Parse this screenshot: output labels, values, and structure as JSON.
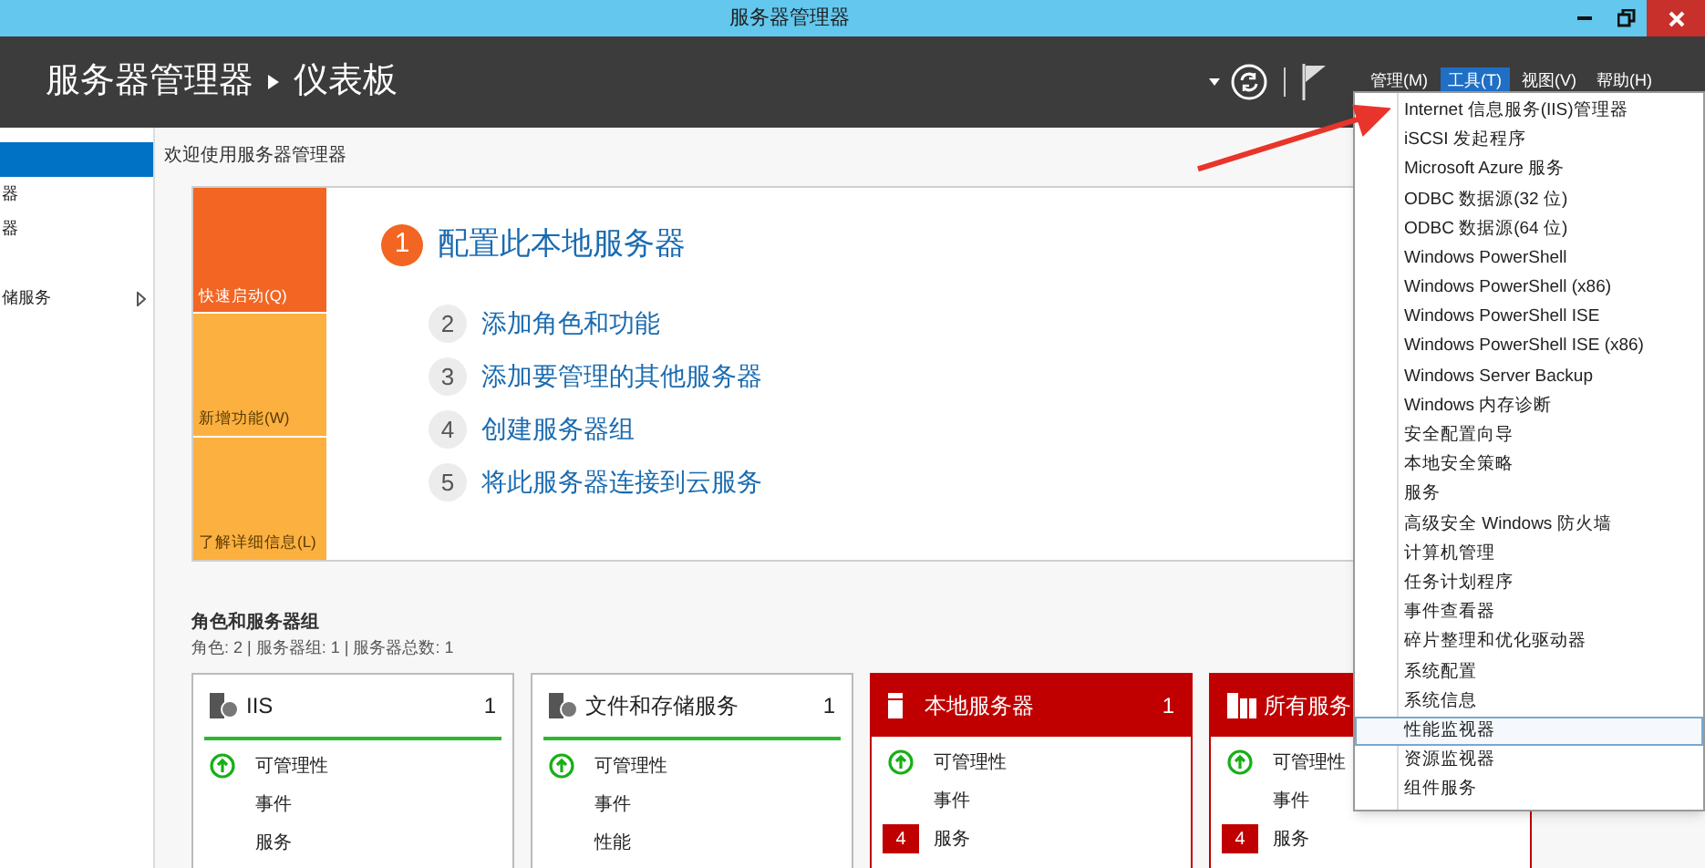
{
  "window": {
    "title": "服务器管理器"
  },
  "header": {
    "breadcrumb": [
      "服务器管理器",
      "仪表板"
    ],
    "menus": [
      {
        "label": "管理(M)",
        "selected": false
      },
      {
        "label": "工具(T)",
        "selected": true
      },
      {
        "label": "视图(V)",
        "selected": false
      },
      {
        "label": "帮助(H)",
        "selected": false
      }
    ]
  },
  "sidebar": {
    "items": [
      {
        "selected": true,
        "expandable": false
      },
      {
        "label": "器",
        "selected": false,
        "expandable": false
      },
      {
        "label": "器",
        "selected": false,
        "expandable": false
      },
      {
        "label": "储服务",
        "selected": false,
        "expandable": true
      }
    ]
  },
  "welcome": {
    "title": "欢迎使用服务器管理器",
    "tiles": [
      {
        "label": "快速启动(Q)",
        "selected": true
      },
      {
        "label": "新增功能(W)",
        "selected": false
      },
      {
        "label": "了解详细信息(L)",
        "selected": false
      }
    ],
    "steps": [
      {
        "number": "1",
        "label": "配置此本地服务器",
        "kind": "primary"
      },
      {
        "number": "2",
        "label": "添加角色和功能",
        "kind": "secondary"
      },
      {
        "number": "3",
        "label": "添加要管理的其他服务器",
        "kind": "secondary"
      },
      {
        "number": "4",
        "label": "创建服务器组",
        "kind": "secondary"
      },
      {
        "number": "5",
        "label": "将此服务器连接到云服务",
        "kind": "secondary"
      }
    ]
  },
  "roles": {
    "title": "角色和服务器组",
    "summary": "角色: 2 | 服务器组: 1 | 服务器总数: 1",
    "cards": [
      {
        "title": "IIS",
        "count": "1",
        "kind": "role",
        "rows": [
          {
            "label": "可管理性",
            "healthy": true
          },
          {
            "label": "事件",
            "healthy": false
          },
          {
            "label": "服务",
            "healthy": false
          }
        ]
      },
      {
        "title": "文件和存储服务",
        "count": "1",
        "kind": "role",
        "rows": [
          {
            "label": "可管理性",
            "healthy": true
          },
          {
            "label": "事件",
            "healthy": false
          },
          {
            "label": "性能",
            "healthy": false
          }
        ]
      },
      {
        "title": "本地服务器",
        "count": "1",
        "kind": "server",
        "rows": [
          {
            "label": "可管理性",
            "healthy": true
          },
          {
            "label": "事件",
            "healthy": false
          },
          {
            "label": "服务",
            "healthy": false,
            "badge": "4"
          }
        ]
      },
      {
        "title": "所有服务",
        "kind": "servers",
        "rows": [
          {
            "label": "可管理性",
            "healthy": true
          },
          {
            "label": "事件",
            "healthy": false
          },
          {
            "label": "服务",
            "healthy": false,
            "badge": "4"
          }
        ]
      }
    ]
  },
  "tools_menu": {
    "items": [
      {
        "label": "Internet 信息服务(IIS)管理器",
        "selected": false
      },
      {
        "label": "iSCSI 发起程序",
        "selected": false
      },
      {
        "label": "Microsoft Azure 服务",
        "selected": false
      },
      {
        "label": "ODBC 数据源(32 位)",
        "selected": false
      },
      {
        "label": "ODBC 数据源(64 位)",
        "selected": false
      },
      {
        "label": "Windows PowerShell",
        "selected": false
      },
      {
        "label": "Windows PowerShell (x86)",
        "selected": false
      },
      {
        "label": "Windows PowerShell ISE",
        "selected": false
      },
      {
        "label": "Windows PowerShell ISE (x86)",
        "selected": false
      },
      {
        "label": "Windows Server Backup",
        "selected": false
      },
      {
        "label": "Windows 内存诊断",
        "selected": false
      },
      {
        "label": "安全配置向导",
        "selected": false
      },
      {
        "label": "本地安全策略",
        "selected": false
      },
      {
        "label": "服务",
        "selected": false
      },
      {
        "label": "高级安全 Windows 防火墙",
        "selected": false
      },
      {
        "label": "计算机管理",
        "selected": false
      },
      {
        "label": "任务计划程序",
        "selected": false
      },
      {
        "label": "事件查看器",
        "selected": false
      },
      {
        "label": "碎片整理和优化驱动器",
        "selected": false
      },
      {
        "label": "系统配置",
        "selected": false
      },
      {
        "label": "系统信息",
        "selected": false
      },
      {
        "label": "性能监视器",
        "selected": true
      },
      {
        "label": "资源监视器",
        "selected": false
      },
      {
        "label": "组件服务",
        "selected": false
      }
    ]
  }
}
